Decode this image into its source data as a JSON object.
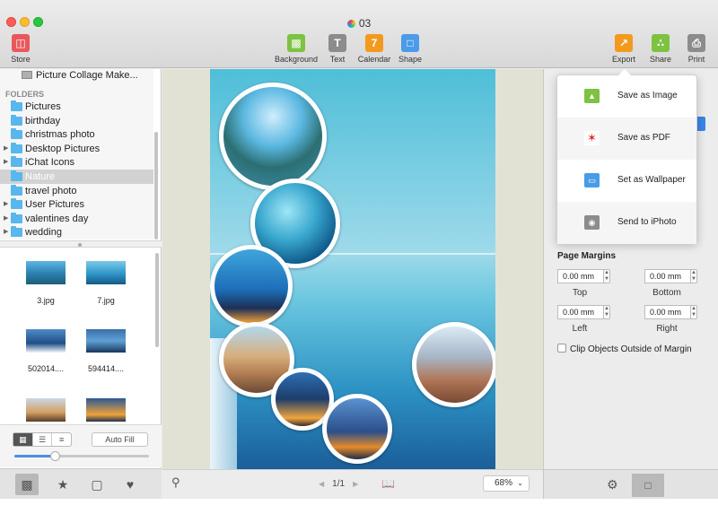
{
  "window": {
    "title": "03",
    "toolbar": {
      "store": "Store",
      "background": "Background",
      "text": "Text",
      "calendar": "Calendar",
      "shape": "Shape",
      "export": "Export",
      "share": "Share",
      "print": "Print"
    }
  },
  "sidebar": {
    "root": "Picture Collage Make...",
    "folders_header": "FOLDERS",
    "folders": [
      {
        "label": "Pictures",
        "expandable": false,
        "selected": false
      },
      {
        "label": "birthday",
        "expandable": false,
        "selected": false
      },
      {
        "label": "christmas photo",
        "expandable": false,
        "selected": false
      },
      {
        "label": "Desktop Pictures",
        "expandable": true,
        "selected": false
      },
      {
        "label": "iChat Icons",
        "expandable": true,
        "selected": false
      },
      {
        "label": "Nature",
        "expandable": false,
        "selected": true
      },
      {
        "label": "travel photo",
        "expandable": false,
        "selected": false
      },
      {
        "label": "User Pictures",
        "expandable": true,
        "selected": false
      },
      {
        "label": "valentines day",
        "expandable": true,
        "selected": false
      },
      {
        "label": "wedding",
        "expandable": true,
        "selected": false
      }
    ],
    "thumbnails": [
      {
        "name": "3.jpg"
      },
      {
        "name": "7.jpg"
      },
      {
        "name": "502014...."
      },
      {
        "name": "594414...."
      },
      {
        "name": ""
      },
      {
        "name": ""
      }
    ],
    "view_modes": [
      "grid",
      "list",
      "detail"
    ],
    "auto_fill": "Auto Fill",
    "thumb_size": 0.3,
    "bottom_tabs": [
      "photos",
      "favorites",
      "frames",
      "likes"
    ]
  },
  "canvas": {
    "page_indicator": "1/1",
    "zoom": "68%"
  },
  "export_menu": {
    "items": [
      {
        "label": "Save as Image",
        "icon": "image-icon",
        "color": "#7dc242"
      },
      {
        "label": "Save as PDF",
        "icon": "pdf-icon",
        "color": "#e0322b"
      },
      {
        "label": "Set as Wallpaper",
        "icon": "monitor-icon",
        "color": "#4a9be8"
      },
      {
        "label": "Send to iPhoto",
        "icon": "camera-icon",
        "color": "#8c8c8c"
      }
    ]
  },
  "right_panel": {
    "page_margins_title": "Page Margins",
    "top": {
      "value": "0.00 mm",
      "label": "Top"
    },
    "bottom": {
      "value": "0.00 mm",
      "label": "Bottom"
    },
    "left": {
      "value": "0.00 mm",
      "label": "Left"
    },
    "right": {
      "value": "0.00 mm",
      "label": "Right"
    },
    "clip_label": "Clip Objects Outside of Margin",
    "clip_checked": false
  },
  "colors": {
    "accent": "#3a86e8",
    "store": "#e9585d",
    "background_tool": "#7dc242",
    "text_tool": "#8c8c8c",
    "calendar_tool": "#f39a1e",
    "shape_tool": "#4a9be8",
    "export_tool": "#f39a1e",
    "share_tool": "#7dc242",
    "print_tool": "#8c8c8c"
  }
}
